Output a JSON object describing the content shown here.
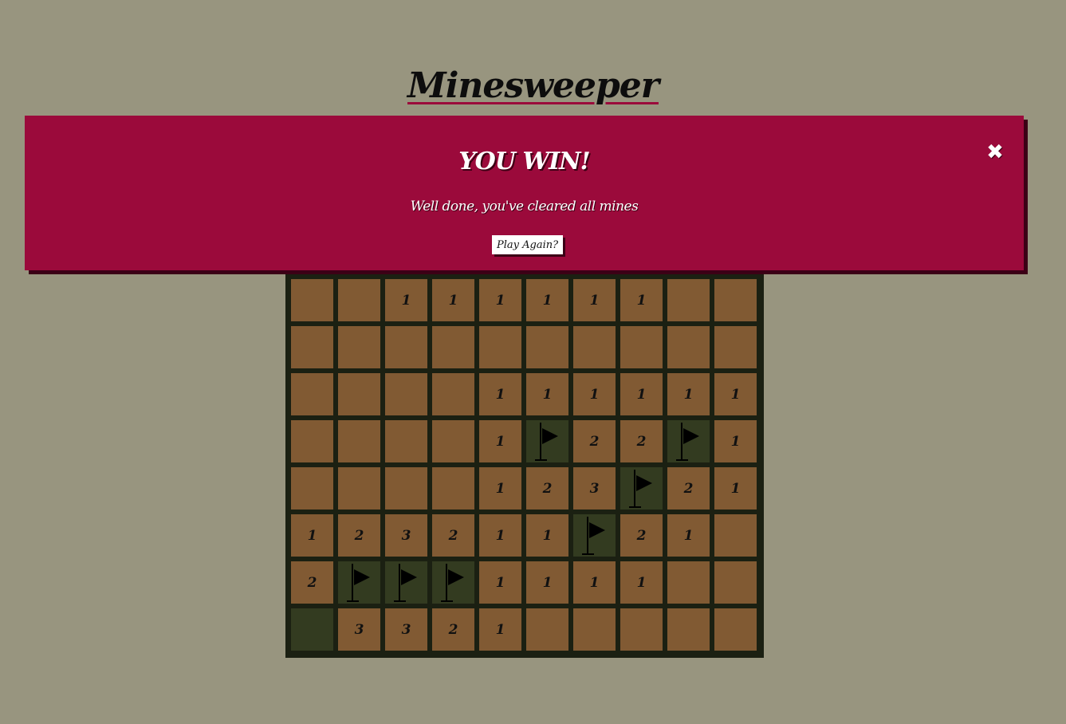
{
  "app": {
    "title": "Minesweeper"
  },
  "modal": {
    "title": "YOU WIN!",
    "message": "Well done, you've cleared all mines",
    "play_again_label": "Play Again?",
    "close_icon": "close-icon",
    "close_glyph": "✖"
  },
  "colors": {
    "background": "#98957f",
    "board_border": "#1b2012",
    "revealed_cell": "#815a33",
    "flagged_cell": "#333b20",
    "modal": "#9b0a3b",
    "modal_shadow": "#3c0016"
  },
  "board": {
    "columns": 10,
    "visible_rows": 8,
    "legend": "F = flagged, H = hidden, empty = revealed blank",
    "rows": [
      [
        "",
        "",
        "1",
        "1",
        "1",
        "1",
        "1",
        "1",
        "",
        ""
      ],
      [
        "",
        "",
        "",
        "",
        "",
        "",
        "",
        "",
        "",
        ""
      ],
      [
        "",
        "",
        "",
        "",
        "1",
        "1",
        "1",
        "1",
        "1",
        "1"
      ],
      [
        "",
        "",
        "",
        "",
        "1",
        "F",
        "2",
        "2",
        "F",
        "1"
      ],
      [
        "",
        "",
        "",
        "",
        "1",
        "2",
        "3",
        "F",
        "2",
        "1"
      ],
      [
        "1",
        "2",
        "3",
        "2",
        "1",
        "1",
        "F",
        "2",
        "1",
        ""
      ],
      [
        "2",
        "F",
        "F",
        "F",
        "1",
        "1",
        "1",
        "1",
        "",
        ""
      ],
      [
        "H",
        "3",
        "3",
        "2",
        "1",
        "",
        "",
        "",
        "",
        ""
      ]
    ]
  }
}
